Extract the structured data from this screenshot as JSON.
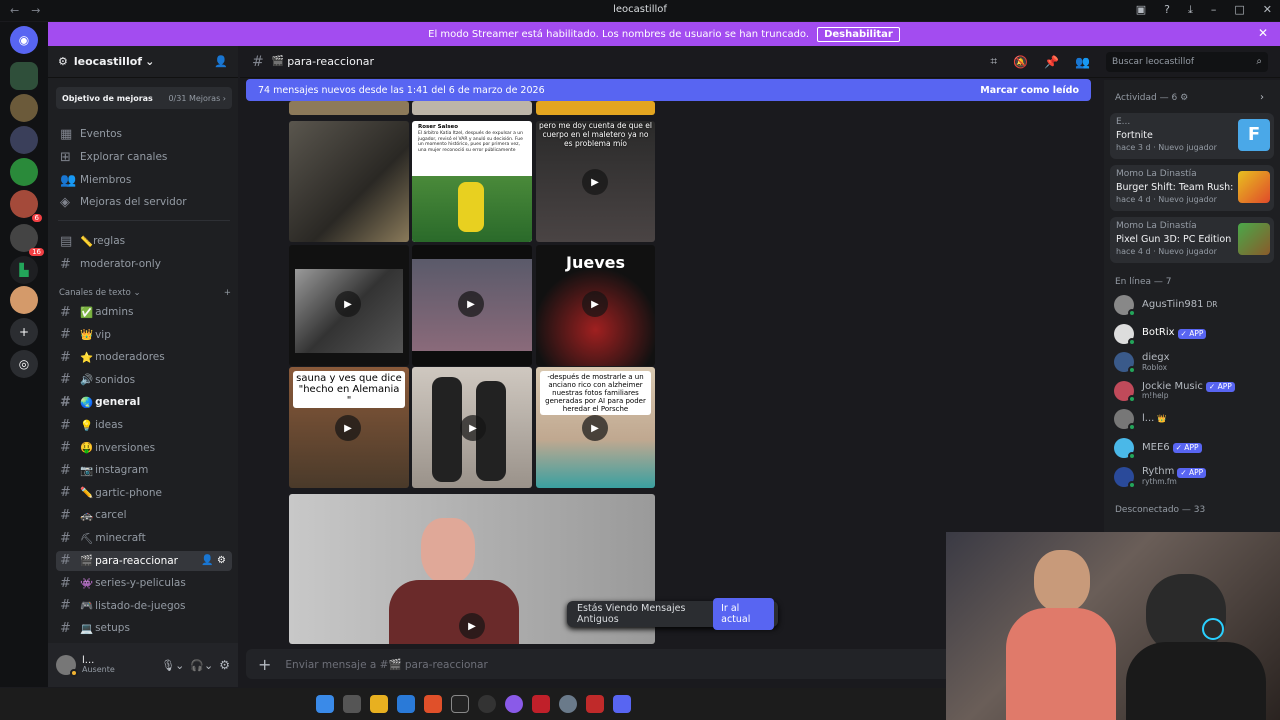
{
  "window": {
    "title": "leocastillof",
    "back": "←",
    "forward": "→"
  },
  "streamer": {
    "text": "El modo Streamer está habilitado. Los nombres de usuario se han truncado.",
    "button": "Deshabilitar",
    "close": "✕"
  },
  "guild": {
    "name": "leocastillof",
    "chevron": "⌄"
  },
  "boost": {
    "label": "Objetivo de mejoras",
    "progress": "0/31 Mejoras ›"
  },
  "nav": [
    "Eventos",
    "Explorar canales",
    "Miembros",
    "Mejoras del servidor"
  ],
  "channels_top": [
    {
      "icon": "📏",
      "name": "reglas"
    },
    {
      "icon": "",
      "name": "moderator-only"
    }
  ],
  "category": {
    "label": "Canales de texto ⌄",
    "add": "+"
  },
  "channels": [
    {
      "icon": "✅",
      "name": "admins"
    },
    {
      "icon": "👑",
      "name": "vip"
    },
    {
      "icon": "⭐",
      "name": "moderadores"
    },
    {
      "icon": "🔊",
      "name": "sonidos"
    },
    {
      "icon": "🌏",
      "name": "general"
    },
    {
      "icon": "💡",
      "name": "ideas"
    },
    {
      "icon": "🤑",
      "name": "inversiones"
    },
    {
      "icon": "📷",
      "name": "instagram"
    },
    {
      "icon": "✏️",
      "name": "gartic-phone"
    },
    {
      "icon": "🚓",
      "name": "carcel"
    },
    {
      "icon": "⛏",
      "name": "minecraft"
    },
    {
      "icon": "🎬",
      "name": "para-reaccionar"
    },
    {
      "icon": "👾",
      "name": "series-y-peliculas"
    },
    {
      "icon": "🎮",
      "name": "listado-de-juegos"
    },
    {
      "icon": "💻",
      "name": "setups"
    }
  ],
  "user": {
    "name": "l...",
    "status": "Ausente"
  },
  "header": {
    "channel": "para-reaccionar",
    "channel_icon": "🎬",
    "search_placeholder": "Buscar leocastillof"
  },
  "banner": {
    "text": "74 mensajes nuevos desde las 1:41 del 6 de marzo de 2026",
    "action": "Marcar como leído"
  },
  "captions": {
    "t1": "pero me doy cuenta de que el cuerpo en el maletero ya no es problema mío",
    "t2": "Jueves",
    "t3": "sauna y ves que dice \"hecho en Alemania \"",
    "t4": "-después de mostrarle a un anciano rico con alzheimer nuestras fotos familiares generadas por AI para poder heredar el Porsche",
    "tweet_user": "Roser Salseo",
    "tweet_text": "El árbitro Katia Itzel, después de expulsar a un jugador, revisó el VAR y anuló su decisión. Fue un momento histórico, pues por primera vez, una mujer reconoció su error públicamente"
  },
  "oldmsgs": {
    "text": "Estás Viendo Mensajes Antiguos",
    "button": "Ir al actual"
  },
  "composer": {
    "placeholder": "Enviar mensaje a #🎬 para-reaccionar",
    "plus": "+"
  },
  "activity": {
    "header": "Actividad — 6",
    "items": [
      {
        "user": "E...",
        "game": "Fortnite",
        "meta": "hace 3 d",
        "tag": "Nuevo jugador"
      },
      {
        "user": "Momo La Dinastía",
        "game": "Burger Shift: Team Rush: P...",
        "meta": "hace 4 d",
        "tag": "Nuevo jugador"
      },
      {
        "user": "Momo La Dinastía",
        "game": "Pixel Gun 3D: PC Edition",
        "meta": "hace 4 d",
        "tag": "Nuevo jugador"
      }
    ]
  },
  "online": {
    "header": "En línea — 7",
    "members": [
      {
        "name": "AgusTiin981",
        "badge": "DR",
        "sub": ""
      },
      {
        "name": "BotRix",
        "badge": "✓ APP",
        "sub": ""
      },
      {
        "name": "diegx",
        "badge": "",
        "sub": "Roblox"
      },
      {
        "name": "Jockie Music",
        "badge": "✓ APP",
        "sub": "m!help"
      },
      {
        "name": "l...",
        "badge": "👑",
        "sub": ""
      },
      {
        "name": "MEE6",
        "badge": "✓ APP",
        "sub": ""
      },
      {
        "name": "Rythm",
        "badge": "✓ APP",
        "sub": "rythm.fm"
      }
    ]
  },
  "offline": {
    "header": "Desconectado — 33"
  },
  "badges": {
    "s6": "6",
    "s16": "16"
  }
}
